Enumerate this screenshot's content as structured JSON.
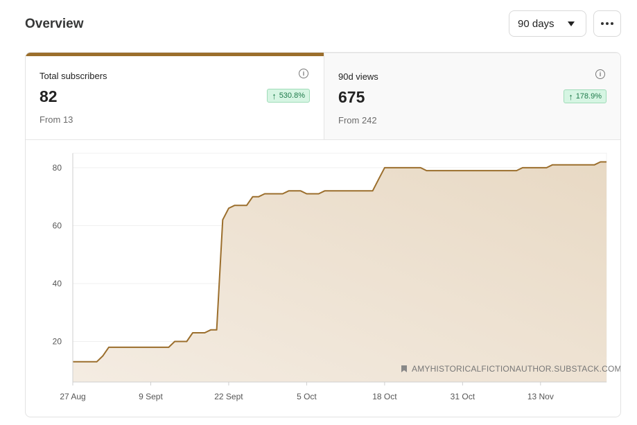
{
  "header": {
    "title": "Overview",
    "range_label": "90 days"
  },
  "stats": [
    {
      "label": "Total subscribers",
      "value": "82",
      "change": "530.8%",
      "from": "From 13"
    },
    {
      "label": "90d views",
      "value": "675",
      "change": "178.9%",
      "from": "From 242"
    }
  ],
  "colors": {
    "accent": "#9b6e2c",
    "area_fill": "#e8d9c4",
    "badge_bg": "#d6f5e3",
    "badge_text": "#1e7a4a"
  },
  "watermark": "AMYHISTORICALFICTIONAUTHOR.SUBSTACK.COM",
  "chart_data": {
    "type": "area",
    "xlabel": "",
    "ylabel": "",
    "ylim": [
      6,
      85
    ],
    "yticks": [
      20,
      40,
      60,
      80
    ],
    "xticks": [
      "27 Aug",
      "9 Sept",
      "22 Sept",
      "5 Oct",
      "18 Oct",
      "31 Oct",
      "13 Nov"
    ],
    "grid": true,
    "x": [
      "27 Aug",
      "28 Aug",
      "29 Aug",
      "30 Aug",
      "31 Aug",
      "1 Sept",
      "2 Sept",
      "3 Sept",
      "4 Sept",
      "5 Sept",
      "6 Sept",
      "7 Sept",
      "8 Sept",
      "9 Sept",
      "10 Sept",
      "11 Sept",
      "12 Sept",
      "13 Sept",
      "14 Sept",
      "15 Sept",
      "16 Sept",
      "17 Sept",
      "18 Sept",
      "19 Sept",
      "20 Sept",
      "21 Sept",
      "22 Sept",
      "23 Sept",
      "24 Sept",
      "25 Sept",
      "26 Sept",
      "27 Sept",
      "28 Sept",
      "29 Sept",
      "30 Sept",
      "1 Oct",
      "2 Oct",
      "3 Oct",
      "4 Oct",
      "5 Oct",
      "6 Oct",
      "7 Oct",
      "8 Oct",
      "9 Oct",
      "10 Oct",
      "11 Oct",
      "12 Oct",
      "13 Oct",
      "14 Oct",
      "15 Oct",
      "16 Oct",
      "17 Oct",
      "18 Oct",
      "19 Oct",
      "20 Oct",
      "21 Oct",
      "22 Oct",
      "23 Oct",
      "24 Oct",
      "25 Oct",
      "26 Oct",
      "27 Oct",
      "28 Oct",
      "29 Oct",
      "30 Oct",
      "31 Oct",
      "1 Nov",
      "2 Nov",
      "3 Nov",
      "4 Nov",
      "5 Nov",
      "6 Nov",
      "7 Nov",
      "8 Nov",
      "9 Nov",
      "10 Nov",
      "11 Nov",
      "12 Nov",
      "13 Nov",
      "14 Nov",
      "15 Nov",
      "16 Nov",
      "17 Nov",
      "18 Nov",
      "19 Nov",
      "20 Nov",
      "21 Nov",
      "22 Nov",
      "23 Nov",
      "24 Nov"
    ],
    "series": [
      {
        "values": [
          13,
          13,
          13,
          13,
          13,
          15,
          18,
          18,
          18,
          18,
          18,
          18,
          18,
          18,
          18,
          18,
          18,
          20,
          20,
          20,
          23,
          23,
          23,
          24,
          24,
          62,
          66,
          67,
          67,
          67,
          70,
          70,
          71,
          71,
          71,
          71,
          72,
          72,
          72,
          71,
          71,
          71,
          72,
          72,
          72,
          72,
          72,
          72,
          72,
          72,
          72,
          76,
          80,
          80,
          80,
          80,
          80,
          80,
          80,
          79,
          79,
          79,
          79,
          79,
          79,
          79,
          79,
          79,
          79,
          79,
          79,
          79,
          79,
          79,
          79,
          80,
          80,
          80,
          80,
          80,
          81,
          81,
          81,
          81,
          81,
          81,
          81,
          81,
          82,
          82
        ]
      }
    ]
  }
}
